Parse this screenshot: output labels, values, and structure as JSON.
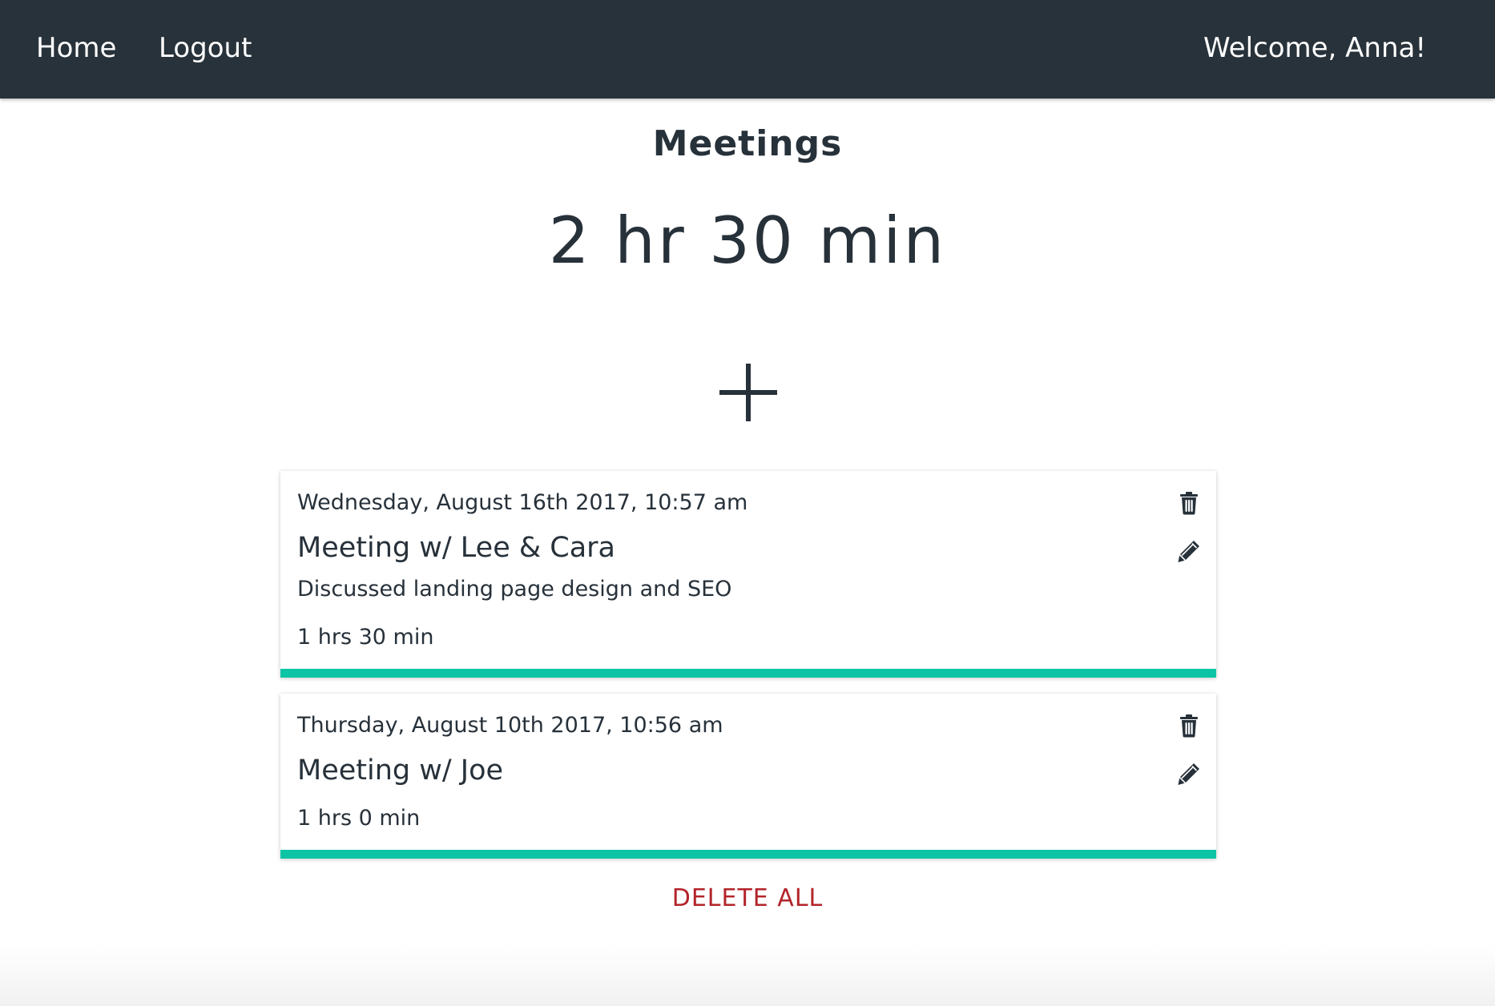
{
  "nav": {
    "home_label": "Home",
    "logout_label": "Logout",
    "welcome_text": "Welcome, Anna!"
  },
  "main": {
    "heading": "Meetings",
    "total_time": "2 hr 30 min",
    "add_icon": "plus-icon"
  },
  "meetings": [
    {
      "date": "Wednesday, August 16th 2017, 10:57 am",
      "title": "Meeting w/ Lee & Cara",
      "description": "Discussed landing page design and SEO",
      "duration": "1 hrs 30 min"
    },
    {
      "date": "Thursday, August 10th 2017, 10:56 am",
      "title": "Meeting w/ Joe",
      "description": "",
      "duration": "1 hrs 0 min"
    }
  ],
  "actions": {
    "delete_all_label": "DELETE ALL",
    "delete_icon": "trash-icon",
    "edit_icon": "pencil-icon"
  },
  "colors": {
    "navbar": "#28323a",
    "text": "#27313a",
    "accent": "#0dc4a5",
    "danger": "#b3242a"
  }
}
